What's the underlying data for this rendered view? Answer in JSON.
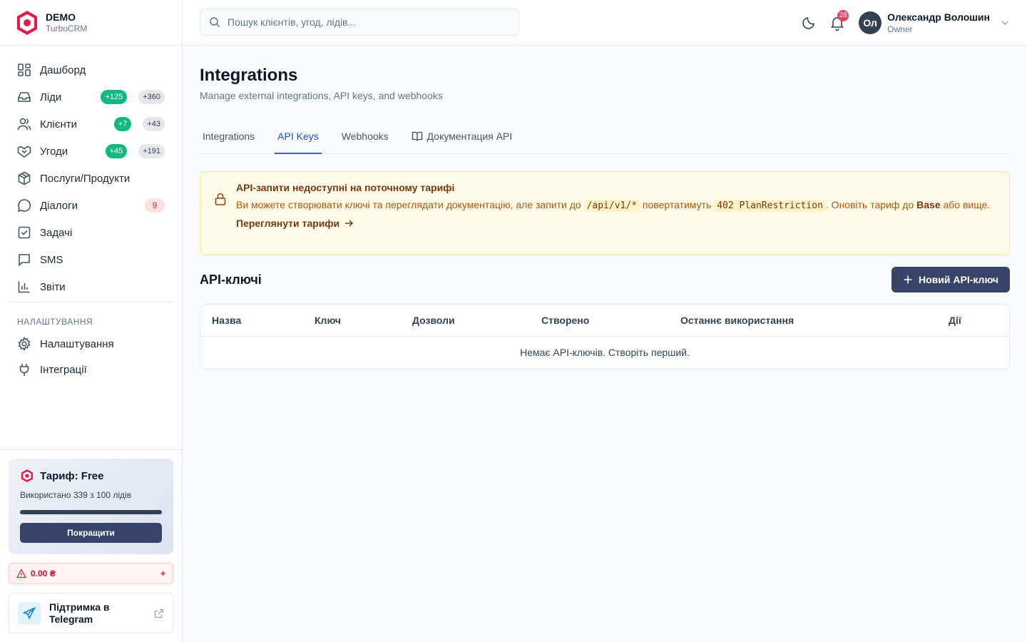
{
  "brand": {
    "name": "DEMO",
    "sub": "TurboCRM"
  },
  "nav": {
    "items": [
      {
        "label": "Дашборд",
        "icon": "dashboard-icon"
      },
      {
        "label": "Ліди",
        "icon": "inbox-icon",
        "badge_new": "+125",
        "badge_total": "+360"
      },
      {
        "label": "Клієнти",
        "icon": "users-icon",
        "badge_new": "+7",
        "badge_total": "+43"
      },
      {
        "label": "Угоди",
        "icon": "handshake-icon",
        "badge_new": "+45",
        "badge_total": "+191"
      },
      {
        "label": "Послуги/Продукти",
        "icon": "package-icon"
      },
      {
        "label": "Діалоги",
        "icon": "chat-icon",
        "badge_count": "9"
      },
      {
        "label": "Задачі",
        "icon": "checkbox-icon"
      },
      {
        "label": "SMS",
        "icon": "message-icon"
      },
      {
        "label": "Звіти",
        "icon": "chart-icon"
      }
    ],
    "section_title": "НАЛАШТУВАННЯ",
    "settings_items": [
      {
        "label": "Налаштування",
        "icon": "gear-icon"
      },
      {
        "label": "Інтеграції",
        "icon": "plug-icon"
      }
    ]
  },
  "plan": {
    "title": "Тариф: Free",
    "usage": "Використано 339 з 100 лідів",
    "progress": 1.0,
    "upgrade_label": "Покращити"
  },
  "balance": {
    "amount": "0.00 ₴",
    "plus": "+"
  },
  "support": {
    "label": "Підтримка в Telegram"
  },
  "search": {
    "placeholder": "Пошук клієнтів, угод, лідів..."
  },
  "notifications": {
    "count": "28"
  },
  "user": {
    "initials": "Ол",
    "name": "Олександр Волошин",
    "role": "Owner"
  },
  "page": {
    "title": "Integrations",
    "subtitle": "Manage external integrations, API keys, and webhooks"
  },
  "tabs": [
    {
      "label": "Integrations",
      "active": false
    },
    {
      "label": "API Keys",
      "active": true
    },
    {
      "label": "Webhooks",
      "active": false
    },
    {
      "label": "Документация API",
      "active": false
    }
  ],
  "alert": {
    "title": "API-запити недоступні на поточному тарифі",
    "body_pre": "Ви можете створювати ключі та переглядати документацію, але запити до ",
    "code1": "/api/v1/*",
    "body_mid": " повертатимуть ",
    "code2": "402 PlanRestriction",
    "body_post": ". Оновіть тариф до ",
    "plan_name": "Base",
    "body_end": " або вище.",
    "link": "Переглянути тарифи"
  },
  "api_keys": {
    "title": "API-ключі",
    "new_button": "Новий API-ключ",
    "columns": [
      "Назва",
      "Ключ",
      "Дозволи",
      "Створено",
      "Останнє використання",
      "Дії"
    ],
    "empty": "Немає API-ключів. Створіть перший."
  },
  "colors": {
    "accent": "#354468",
    "primary_tab": "#2563eb",
    "success": "#10b981",
    "danger": "#f43f5e"
  }
}
